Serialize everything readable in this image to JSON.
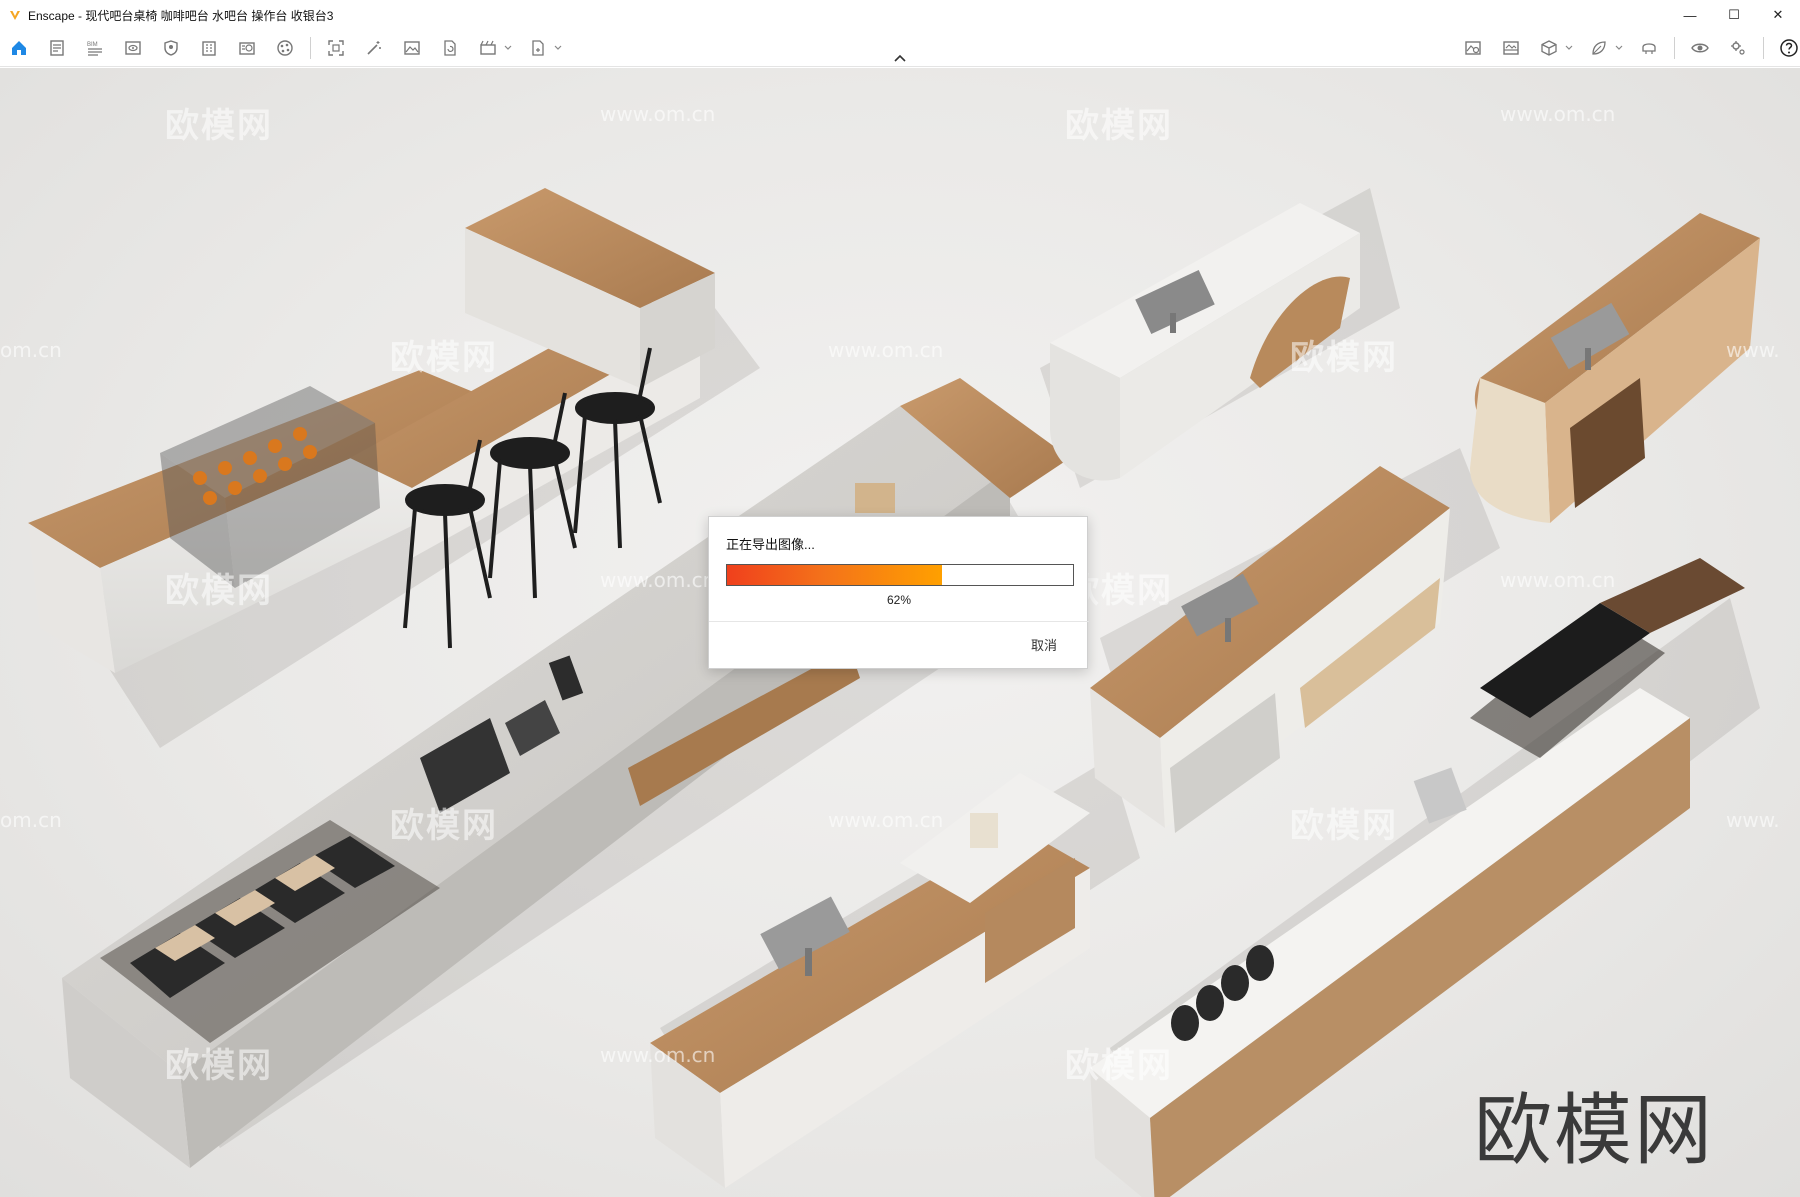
{
  "window": {
    "title": "Enscape - 现代吧台桌椅 咖啡吧台 水吧台 操作台 收银台3",
    "minimize_label": "—",
    "maximize_label": "☐",
    "close_label": "✕"
  },
  "toolbar": {
    "left": [
      {
        "name": "home-icon"
      },
      {
        "name": "document-icon"
      },
      {
        "name": "bim-icon",
        "text": "BIM"
      },
      {
        "name": "view-icon"
      },
      {
        "name": "shield-icon"
      },
      {
        "name": "building-icon"
      },
      {
        "name": "asset-library-icon"
      },
      {
        "name": "materials-icon"
      },
      {
        "name": "screenshot-icon"
      },
      {
        "name": "magic-wand-icon"
      },
      {
        "name": "image-icon"
      },
      {
        "name": "refresh-icon"
      },
      {
        "name": "video-icon",
        "dropdown": true
      },
      {
        "name": "export-icon",
        "dropdown": true
      }
    ],
    "right": [
      {
        "name": "map-icon"
      },
      {
        "name": "gallery-icon"
      },
      {
        "name": "cube-icon",
        "dropdown": true
      },
      {
        "name": "leaf-icon",
        "dropdown": true
      },
      {
        "name": "vr-headset-icon"
      },
      {
        "name": "eye-icon"
      },
      {
        "name": "settings-icon"
      },
      {
        "name": "help-icon"
      }
    ],
    "accent_color": "#1e88e5"
  },
  "watermarks": {
    "brand": "欧模网",
    "url": "www.om.cn",
    "url_short": "om.cn",
    "url_prefix": "www."
  },
  "dialog": {
    "title": "正在导出图像...",
    "progress_percent": 62,
    "progress_label": "62%",
    "cancel_label": "取消"
  }
}
